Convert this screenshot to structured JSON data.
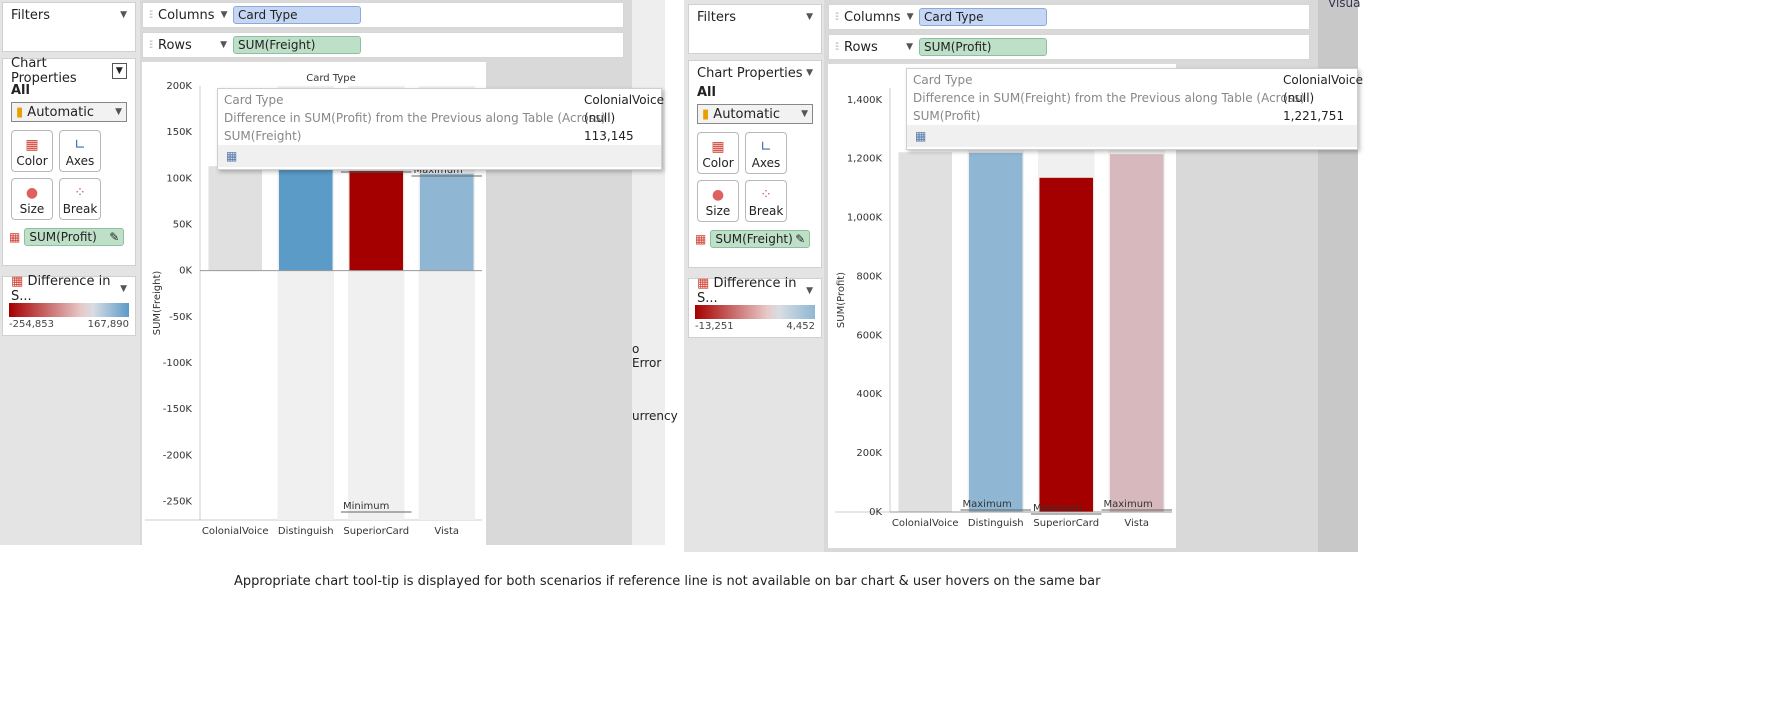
{
  "caption": "Appropriate chart tool-tip is displayed for both scenarios if reference line is not available on bar chart & user hovers on the same bar",
  "left": {
    "filters_label": "Filters",
    "chart_props_label": "Chart Properties",
    "all_label": "All",
    "mark_type": "Automatic",
    "buttons": [
      "Color",
      "Axes",
      "Size",
      "Break"
    ],
    "color_field": "SUM(Profit)",
    "legend_title": "Difference in S...",
    "legend_min": "-254,853",
    "legend_max": "167,890",
    "columns_label": "Columns",
    "columns_pill": "Card Type",
    "rows_label": "Rows",
    "rows_pill": "SUM(Freight)",
    "chart_title": "Card Type",
    "y_axis_label": "SUM(Freight)",
    "ref_labels": {
      "max": "Maximum",
      "min": "Minimum"
    },
    "tooltip": {
      "rows": [
        {
          "k": "Card Type",
          "v": "ColonialVoice"
        },
        {
          "k": "Difference in SUM(Profit) from the Previous along Table (Across)",
          "v": "(null)"
        },
        {
          "k": "SUM(Freight)",
          "v": "113,145"
        }
      ]
    },
    "bg_texts": [
      "o Error",
      "urrency"
    ]
  },
  "right": {
    "filters_label": "Filters",
    "chart_props_label": "Chart Properties",
    "all_label": "All",
    "mark_type": "Automatic",
    "buttons": [
      "Color",
      "Axes",
      "Size",
      "Break"
    ],
    "color_field": "SUM(Freight)",
    "legend_title": "Difference in S...",
    "legend_min": "-13,251",
    "legend_max": "4,452",
    "columns_label": "Columns",
    "columns_pill": "Card Type",
    "rows_label": "Rows",
    "rows_pill": "SUM(Profit)",
    "y_axis_label": "SUM(Profit)",
    "ref_labels": {
      "max": "Maximum"
    },
    "tooltip": {
      "rows": [
        {
          "k": "Card Type",
          "v": "ColonialVoice"
        },
        {
          "k": "Difference in SUM(Freight) from the Previous along Table (Across)",
          "v": "(null)"
        },
        {
          "k": "SUM(Profit)",
          "v": "1,221,751"
        }
      ]
    },
    "bg_texts": [
      "Visua"
    ]
  },
  "colors": {
    "blue_dark": "#5b9bc8",
    "blue_light": "#8fb7d3",
    "red_dark": "#a50000",
    "pink_light": "#d7b9bd",
    "gray_bar": "#e0e0e0"
  },
  "chart_data": [
    {
      "type": "bar",
      "categories": [
        "ColonialVoice",
        "Distinguish",
        "SuperiorCard",
        "Vista"
      ],
      "values": [
        113145,
        110000,
        108000,
        105000
      ],
      "ylabel": "SUM(Freight)",
      "ylim": [
        -270000,
        200000
      ],
      "yticks": [
        200000,
        150000,
        100000,
        50000,
        0,
        -50000,
        -100000,
        -150000,
        -200000,
        -250000
      ],
      "ytick_labels": [
        "200K",
        "150K",
        "100K",
        "50K",
        "0K",
        "-50K",
        "-100K",
        "-150K",
        "-200K",
        "-250K"
      ]
    },
    {
      "type": "bar",
      "categories": [
        "ColonialVoice",
        "Distinguish",
        "SuperiorCard",
        "Vista"
      ],
      "values": [
        1221751,
        1220000,
        1135000,
        1215000
      ],
      "ylabel": "SUM(Profit)",
      "ylim": [
        0,
        1440000
      ],
      "yticks": [
        0,
        200000,
        400000,
        600000,
        800000,
        1000000,
        1200000,
        1400000
      ],
      "ytick_labels": [
        "0K",
        "200K",
        "400K",
        "600K",
        "800K",
        "1,000K",
        "1,200K",
        "1,400K"
      ]
    }
  ]
}
